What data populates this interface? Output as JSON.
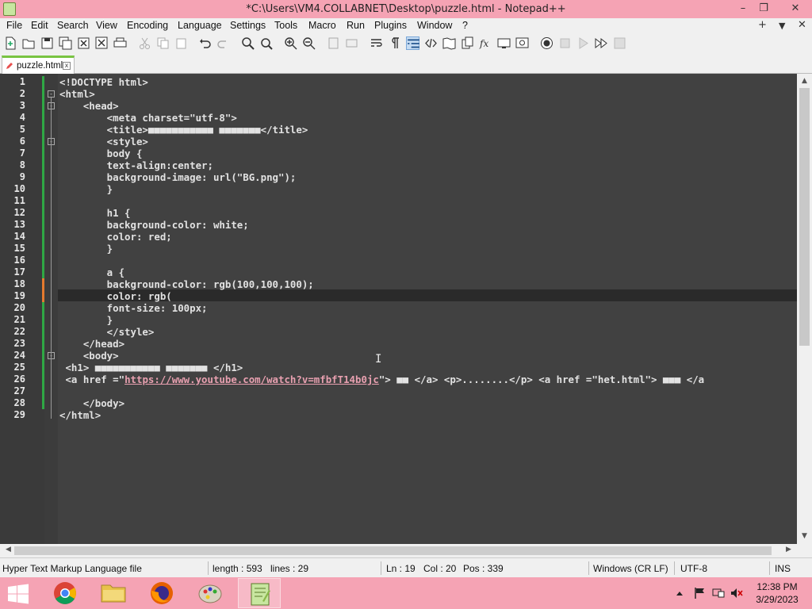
{
  "window": {
    "title": "*C:\\Users\\VM4.COLLABNET\\Desktop\\puzzle.html - Notepad++",
    "controls": [
      "–",
      "❐",
      "✕"
    ]
  },
  "menu": {
    "items": [
      "File",
      "Edit",
      "Search",
      "View",
      "Encoding",
      "Language",
      "Settings",
      "Tools",
      "Macro",
      "Run",
      "Plugins",
      "Window",
      "?"
    ],
    "right": [
      "+",
      "▼",
      "✕"
    ]
  },
  "toolbar": {
    "icons": [
      "new-file-icon",
      "open-file-icon",
      "save-icon",
      "save-all-icon",
      "close-icon",
      "close-all-icon",
      "print-icon",
      "cut-icon",
      "copy-icon",
      "paste-icon",
      "undo-icon",
      "redo-icon",
      "find-icon",
      "replace-icon",
      "zoom-in-icon",
      "zoom-out-icon",
      "sync-vertical-icon",
      "sync-horizontal-icon",
      "word-wrap-icon",
      "show-all-chars-icon",
      "indent-guide-icon",
      "language-icon",
      "document-map-icon",
      "document-list-icon",
      "function-list-icon",
      "folder-workspace-icon",
      "monitoring-icon",
      "record-macro-icon",
      "stop-record-icon",
      "play-macro-icon",
      "run-macro-multiple-icon",
      "save-macro-icon"
    ],
    "active_icon": "indent-guide-icon"
  },
  "tab": {
    "label": "puzzle.html",
    "close": "x"
  },
  "editor": {
    "lines": [
      "<!DOCTYPE html>",
      "<html>",
      "    <head>",
      "        <meta charset=\"utf-8\">",
      "        <title>■■■■■■■■■■■ ■■■■■■■</title>",
      "        <style>",
      "        body {",
      "        text-align:center;",
      "        background-image: url(\"BG.png\");",
      "        }",
      "",
      "        h1 {",
      "        background-color: white;",
      "        color: red;",
      "        }",
      "",
      "        a {",
      "        background-color: rgb(100,100,100);",
      "        color: rgb(",
      "        font-size: 100px;",
      "        }",
      "        </style>",
      "    </head>",
      "    <body>",
      " <h1> ■■■■■■■■■■■ ■■■■■■■ </h1>",
      " <a href =\"https://www.youtube.com/watch?v=mfbfT14b0jc\"> ■■ </a> <p>........</p> <a href =\"het.html\"> ■■■ </a",
      "",
      "    </body>",
      "</html>"
    ],
    "line_numbers": [
      "1",
      "2",
      "3",
      "4",
      "5",
      "6",
      "7",
      "8",
      "9",
      "10",
      "11",
      "12",
      "13",
      "14",
      "15",
      "16",
      "17",
      "18",
      "19",
      "20",
      "21",
      "22",
      "23",
      "24",
      "25",
      "26",
      "27",
      "28",
      "29"
    ],
    "url_text": "https://www.youtube.com/watch?v=mfbfT14b0jc"
  },
  "status": {
    "file_type": "Hyper Text Markup Language file",
    "length": "length : 593",
    "lines": "lines : 29",
    "ln": "Ln : 19",
    "col": "Col : 20",
    "pos": "Pos : 339",
    "eol": "Windows (CR LF)",
    "encoding": "UTF-8",
    "mode": "INS"
  },
  "taskbar": {
    "apps": [
      "chrome-icon",
      "file-explorer-icon",
      "firefox-icon",
      "paint-icon",
      "notepad-plus-plus-icon"
    ],
    "time": "12:38 PM",
    "date": "3/29/2023",
    "tray": [
      "show-hidden-icons",
      "flag-icon",
      "network-icon",
      "volume-muted-icon"
    ]
  },
  "colors": {
    "titlebar": "#f5a3b4",
    "editor_bg": "#414141",
    "caret_line": "#2a2a2a",
    "tab_accent": "#79c442",
    "change_saved": "#2fa844",
    "change_unsaved": "#e57a2e"
  }
}
